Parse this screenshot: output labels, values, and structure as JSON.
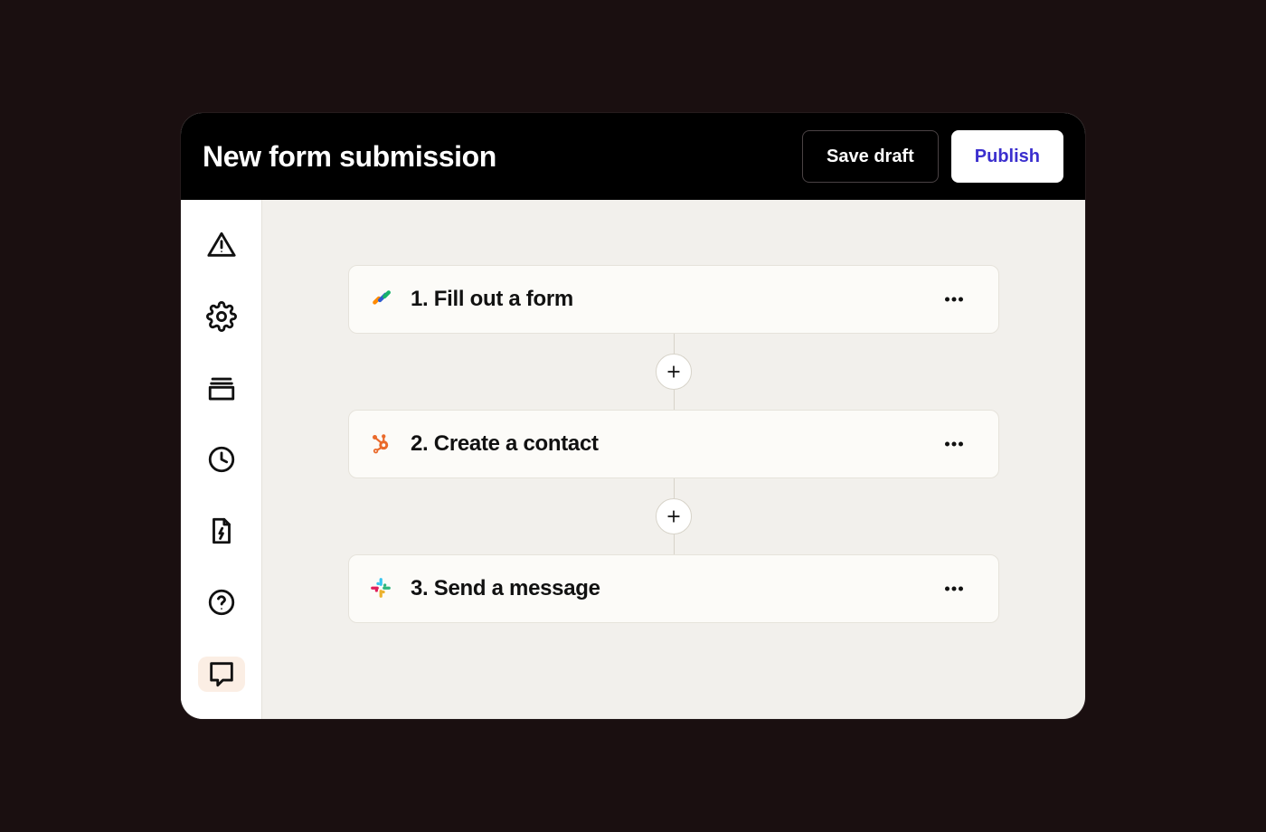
{
  "header": {
    "title": "New form submission",
    "save_draft_label": "Save draft",
    "publish_label": "Publish"
  },
  "sidebar": {
    "items": [
      {
        "name": "warning-icon"
      },
      {
        "name": "gear-icon"
      },
      {
        "name": "stack-icon"
      },
      {
        "name": "clock-icon"
      },
      {
        "name": "file-bolt-icon"
      },
      {
        "name": "help-icon"
      },
      {
        "name": "chat-icon",
        "active": true
      }
    ]
  },
  "flow": {
    "steps": [
      {
        "label": "1. Fill out a form",
        "app": "jotform"
      },
      {
        "label": "2. Create a contact",
        "app": "hubspot"
      },
      {
        "label": "3. Send a message",
        "app": "slack"
      }
    ]
  }
}
